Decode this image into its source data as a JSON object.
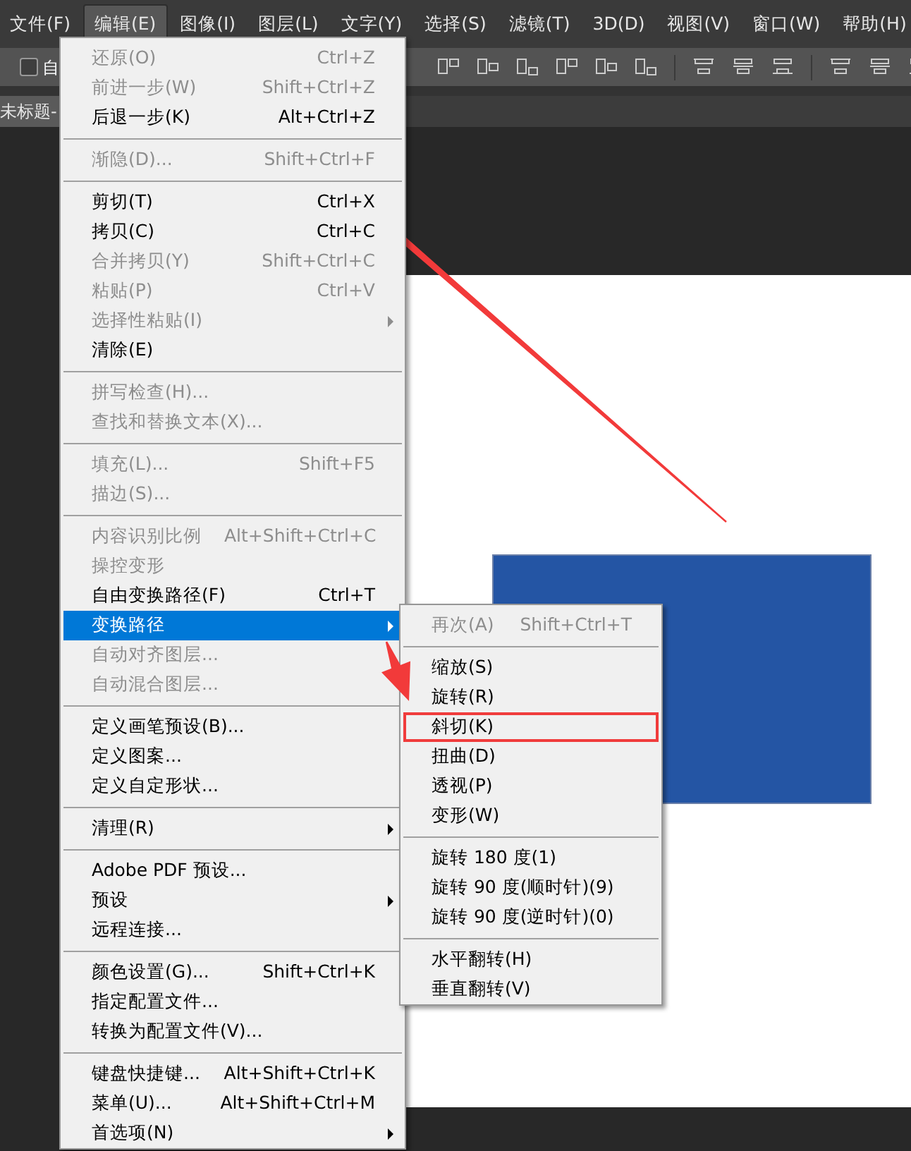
{
  "menu_bar": [
    {
      "label": "文件(F)",
      "selected": false
    },
    {
      "label": "编辑(E)",
      "selected": true
    },
    {
      "label": "图像(I)",
      "selected": false
    },
    {
      "label": "图层(L)",
      "selected": false
    },
    {
      "label": "文字(Y)",
      "selected": false
    },
    {
      "label": "选择(S)",
      "selected": false
    },
    {
      "label": "滤镜(T)",
      "selected": false
    },
    {
      "label": "3D(D)",
      "selected": false
    },
    {
      "label": "视图(V)",
      "selected": false
    },
    {
      "label": "窗口(W)",
      "selected": false
    },
    {
      "label": "帮助(H)",
      "selected": false
    }
  ],
  "options_bar": {
    "checkbox": {
      "label": "自",
      "checked": false
    }
  },
  "document_tab": {
    "title": "未标题-"
  },
  "edit_menu": [
    [
      {
        "label": "还原(O)",
        "shortcut": "Ctrl+Z",
        "disabled": true,
        "submenu": false,
        "selected": false
      },
      {
        "label": "前进一步(W)",
        "shortcut": "Shift+Ctrl+Z",
        "disabled": true,
        "submenu": false,
        "selected": false
      },
      {
        "label": "后退一步(K)",
        "shortcut": "Alt+Ctrl+Z",
        "disabled": false,
        "submenu": false,
        "selected": false
      }
    ],
    [
      {
        "label": "渐隐(D)...",
        "shortcut": "Shift+Ctrl+F",
        "disabled": true,
        "submenu": false,
        "selected": false
      }
    ],
    [
      {
        "label": "剪切(T)",
        "shortcut": "Ctrl+X",
        "disabled": false,
        "submenu": false,
        "selected": false
      },
      {
        "label": "拷贝(C)",
        "shortcut": "Ctrl+C",
        "disabled": false,
        "submenu": false,
        "selected": false
      },
      {
        "label": "合并拷贝(Y)",
        "shortcut": "Shift+Ctrl+C",
        "disabled": true,
        "submenu": false,
        "selected": false
      },
      {
        "label": "粘贴(P)",
        "shortcut": "Ctrl+V",
        "disabled": true,
        "submenu": false,
        "selected": false
      },
      {
        "label": "选择性粘贴(I)",
        "disabled": true,
        "submenu": true,
        "selected": false
      },
      {
        "label": "清除(E)",
        "disabled": false,
        "submenu": false,
        "selected": false
      }
    ],
    [
      {
        "label": "拼写检查(H)...",
        "disabled": true,
        "submenu": false,
        "selected": false
      },
      {
        "label": "查找和替换文本(X)...",
        "disabled": true,
        "submenu": false,
        "selected": false
      }
    ],
    [
      {
        "label": "填充(L)...",
        "shortcut": "Shift+F5",
        "disabled": true,
        "submenu": false,
        "selected": false
      },
      {
        "label": "描边(S)...",
        "disabled": true,
        "submenu": false,
        "selected": false
      }
    ],
    [
      {
        "label": "内容识别比例",
        "shortcut": "Alt+Shift+Ctrl+C",
        "disabled": true,
        "submenu": false,
        "selected": false
      },
      {
        "label": "操控变形",
        "disabled": true,
        "submenu": false,
        "selected": false
      },
      {
        "label": "自由变换路径(F)",
        "shortcut": "Ctrl+T",
        "disabled": false,
        "submenu": false,
        "selected": false
      },
      {
        "label": "变换路径",
        "disabled": false,
        "submenu": true,
        "selected": true
      },
      {
        "label": "自动对齐图层...",
        "disabled": true,
        "submenu": false,
        "selected": false
      },
      {
        "label": "自动混合图层...",
        "disabled": true,
        "submenu": false,
        "selected": false
      }
    ],
    [
      {
        "label": "定义画笔预设(B)...",
        "disabled": false,
        "submenu": false,
        "selected": false
      },
      {
        "label": "定义图案...",
        "disabled": false,
        "submenu": false,
        "selected": false
      },
      {
        "label": "定义自定形状...",
        "disabled": false,
        "submenu": false,
        "selected": false
      }
    ],
    [
      {
        "label": "清理(R)",
        "disabled": false,
        "submenu": true,
        "selected": false
      }
    ],
    [
      {
        "label": "Adobe PDF 预设...",
        "disabled": false,
        "submenu": false,
        "selected": false
      },
      {
        "label": "预设",
        "disabled": false,
        "submenu": true,
        "selected": false
      },
      {
        "label": "远程连接...",
        "disabled": false,
        "submenu": false,
        "selected": false
      }
    ],
    [
      {
        "label": "颜色设置(G)...",
        "shortcut": "Shift+Ctrl+K",
        "disabled": false,
        "submenu": false,
        "selected": false
      },
      {
        "label": "指定配置文件...",
        "disabled": false,
        "submenu": false,
        "selected": false
      },
      {
        "label": "转换为配置文件(V)...",
        "disabled": false,
        "submenu": false,
        "selected": false
      }
    ],
    [
      {
        "label": "键盘快捷键...",
        "shortcut": "Alt+Shift+Ctrl+K",
        "disabled": false,
        "submenu": false,
        "selected": false
      },
      {
        "label": "菜单(U)...",
        "shortcut": "Alt+Shift+Ctrl+M",
        "disabled": false,
        "submenu": false,
        "selected": false
      },
      {
        "label": "首选项(N)",
        "disabled": false,
        "submenu": true,
        "selected": false
      }
    ]
  ],
  "transform_submenu": [
    [
      {
        "label": "再次(A)",
        "shortcut": "Shift+Ctrl+T",
        "disabled": true,
        "highlighted": false
      }
    ],
    [
      {
        "label": "缩放(S)",
        "disabled": false,
        "highlighted": false
      },
      {
        "label": "旋转(R)",
        "disabled": false,
        "highlighted": false
      },
      {
        "label": "斜切(K)",
        "disabled": false,
        "highlighted": true
      },
      {
        "label": "扭曲(D)",
        "disabled": false,
        "highlighted": false
      },
      {
        "label": "透视(P)",
        "disabled": false,
        "highlighted": false
      },
      {
        "label": "变形(W)",
        "disabled": false,
        "highlighted": false
      }
    ],
    [
      {
        "label": "旋转 180 度(1)",
        "disabled": false,
        "highlighted": false
      },
      {
        "label": "旋转 90 度(顺时针)(9)",
        "disabled": false,
        "highlighted": false
      },
      {
        "label": "旋转 90 度(逆时针)(0)",
        "disabled": false,
        "highlighted": false
      }
    ],
    [
      {
        "label": "水平翻转(H)",
        "disabled": false,
        "highlighted": false
      },
      {
        "label": "垂直翻转(V)",
        "disabled": false,
        "highlighted": false
      }
    ]
  ]
}
